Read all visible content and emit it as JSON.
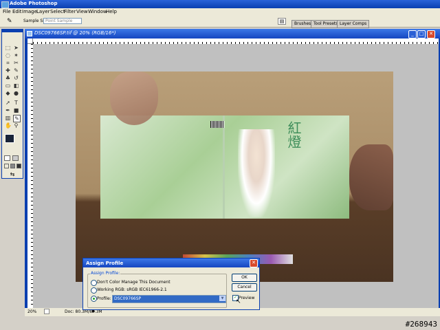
{
  "app": {
    "title": "Adobe Photoshop"
  },
  "menu": [
    "File",
    "Edit",
    "Image",
    "Layer",
    "Select",
    "Filter",
    "View",
    "Window",
    "Help"
  ],
  "options": {
    "sample_size_label": "Sample Size:",
    "sample_size_value": "Point Sample"
  },
  "palettes": [
    "Brushes",
    "Tool Presets",
    "Layer Comps"
  ],
  "document": {
    "title": "DSC09766SP.tif @ 20% (RGB/16*)",
    "zoom": "20%",
    "doc_size": "Doc: 80.3M/80.3M"
  },
  "dialog": {
    "title": "Assign Profile",
    "group_label": "Assign Profile:",
    "option_dont_manage": "Don't Color Manage This Document",
    "option_working": "Working RGB:  sRGB IEC61966-2.1",
    "option_profile": "Profile:",
    "profile_value": "DSC09766SP",
    "selected_option": "profile",
    "ok_label": "OK",
    "cancel_label": "Cancel",
    "preview_label": "Preview",
    "preview_checked": true
  },
  "watermark": "#268943"
}
